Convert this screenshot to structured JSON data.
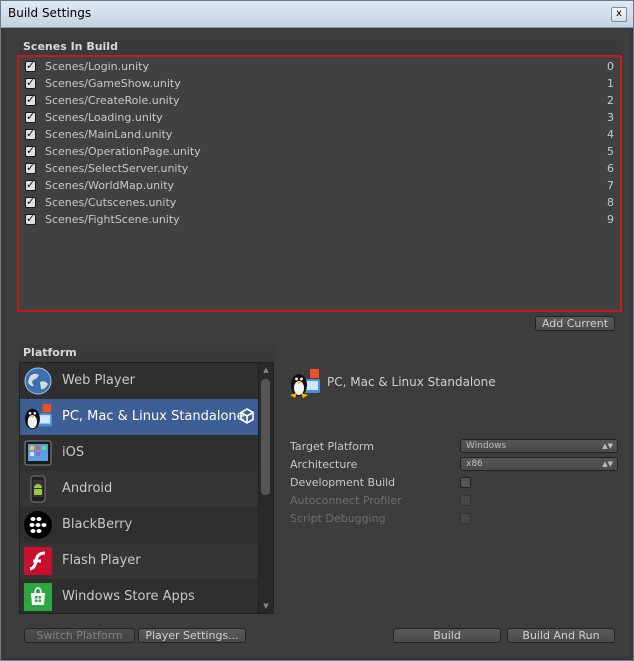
{
  "window": {
    "title": "Build Settings",
    "close_glyph": "x"
  },
  "scenes": {
    "header": "Scenes In Build",
    "items": [
      {
        "name": "Scenes/Login.unity",
        "index": "0",
        "checked": true
      },
      {
        "name": "Scenes/GameShow.unity",
        "index": "1",
        "checked": true
      },
      {
        "name": "Scenes/CreateRole.unity",
        "index": "2",
        "checked": true
      },
      {
        "name": "Scenes/Loading.unity",
        "index": "3",
        "checked": true
      },
      {
        "name": "Scenes/MainLand.unity",
        "index": "4",
        "checked": true
      },
      {
        "name": "Scenes/OperationPage.unity",
        "index": "5",
        "checked": true
      },
      {
        "name": "Scenes/SelectServer.unity",
        "index": "6",
        "checked": true
      },
      {
        "name": "Scenes/WorldMap.unity",
        "index": "7",
        "checked": true
      },
      {
        "name": "Scenes/Cutscenes.unity",
        "index": "8",
        "checked": true
      },
      {
        "name": "Scenes/FightScene.unity",
        "index": "9",
        "checked": true
      }
    ],
    "add_current_label": "Add Current"
  },
  "platform": {
    "header": "Platform",
    "items": [
      {
        "label": "Web Player",
        "icon": "globe-icon",
        "selected": false
      },
      {
        "label": "PC, Mac & Linux Standalone",
        "icon": "standalone-icon",
        "selected": true
      },
      {
        "label": "iOS",
        "icon": "ios-device-icon",
        "selected": false
      },
      {
        "label": "Android",
        "icon": "android-phone-icon",
        "selected": false
      },
      {
        "label": "BlackBerry",
        "icon": "blackberry-icon",
        "selected": false
      },
      {
        "label": "Flash Player",
        "icon": "flash-icon",
        "selected": false
      },
      {
        "label": "Windows Store Apps",
        "icon": "windows-store-icon",
        "selected": false
      }
    ]
  },
  "settings": {
    "title": "PC, Mac & Linux Standalone",
    "target_platform": {
      "label": "Target Platform",
      "value": "Windows"
    },
    "architecture": {
      "label": "Architecture",
      "value": "x86"
    },
    "development_build": {
      "label": "Development Build",
      "checked": false
    },
    "autoconnect_profiler": {
      "label": "Autoconnect Profiler",
      "checked": false,
      "disabled": true
    },
    "script_debugging": {
      "label": "Script Debugging",
      "checked": false,
      "disabled": true
    }
  },
  "buttons": {
    "switch_platform": "Switch Platform",
    "player_settings": "Player Settings...",
    "build": "Build",
    "build_and_run": "Build And Run"
  },
  "colors": {
    "selection": "#3e5f96",
    "highlight_border": "#c81a1a"
  }
}
